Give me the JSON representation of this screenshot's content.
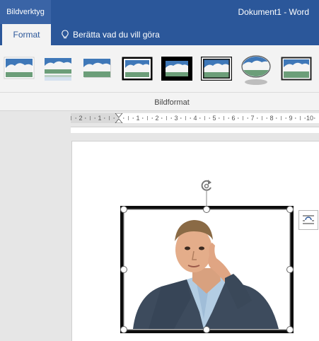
{
  "titlebar": {
    "context_tab": "Bildverktyg",
    "doc_title": "Dokument1  -  Word"
  },
  "tabs": {
    "format": "Format",
    "tell_me": "Berätta vad du vill göra"
  },
  "ribbon": {
    "group_label": "Bildformat",
    "styles": [
      "simple-frame-white",
      "soft-edge-reflection",
      "soft-shadow",
      "simple-frame-black",
      "thick-matte-black",
      "double-frame-black",
      "oval-reflection",
      "metal-frame"
    ]
  },
  "ruler": {
    "marks": [
      "2",
      "1",
      "1",
      "2",
      "3",
      "4",
      "5",
      "6",
      "7",
      "8",
      "9",
      "10"
    ]
  },
  "colors": {
    "title_blue": "#2b579a",
    "ribbon_bg": "#f3f3f3",
    "page_bg": "#ffffff"
  }
}
